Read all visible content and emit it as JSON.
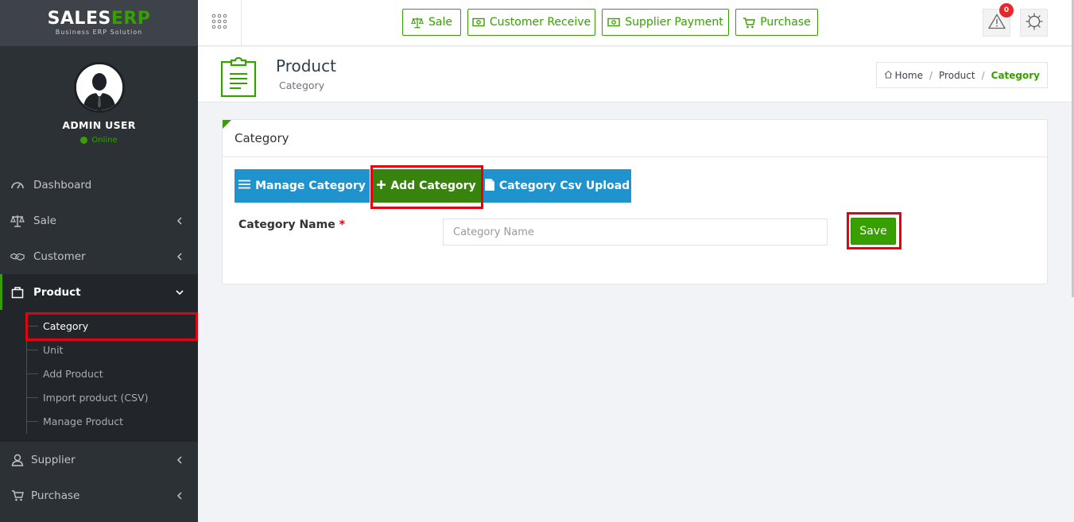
{
  "brand": {
    "logo_part1": "SALES",
    "logo_part2": "ERP",
    "tagline": "Business ERP Solution",
    "accent_color": "#37a000"
  },
  "user": {
    "name": "ADMIN USER",
    "status": "Online"
  },
  "sidebar": {
    "items": [
      {
        "label": "Dashboard",
        "icon": "dashboard-icon"
      },
      {
        "label": "Sale",
        "icon": "scale-icon"
      },
      {
        "label": "Customer",
        "icon": "handshake-icon"
      },
      {
        "label": "Product",
        "icon": "bag-icon",
        "active": true
      },
      {
        "label": "Supplier",
        "icon": "user-icon"
      },
      {
        "label": "Purchase",
        "icon": "cart-icon"
      }
    ],
    "product_submenu": [
      {
        "label": "Category",
        "active": true
      },
      {
        "label": "Unit"
      },
      {
        "label": "Add Product"
      },
      {
        "label": "Import product (CSV)"
      },
      {
        "label": "Manage Product"
      }
    ]
  },
  "topbar": {
    "quick_buttons": [
      {
        "label": "Sale",
        "icon": "scale-icon"
      },
      {
        "label": "Customer Receive",
        "icon": "money-icon"
      },
      {
        "label": "Supplier Payment",
        "icon": "money-icon"
      },
      {
        "label": "Purchase",
        "icon": "cart-icon"
      }
    ],
    "notification_count": "0"
  },
  "page_header": {
    "title": "Product",
    "subtitle": "Category",
    "breadcrumb": [
      "Home",
      "Product",
      "Category"
    ]
  },
  "panel": {
    "heading": "Category",
    "tabs": [
      {
        "label": "Manage Category",
        "icon": "list-icon"
      },
      {
        "label": "Add Category",
        "icon": "plus-icon",
        "active": true
      },
      {
        "label": "Category Csv Upload",
        "icon": "file-icon"
      }
    ],
    "form": {
      "label": "Category Name",
      "required_mark": "*",
      "placeholder": "Category Name",
      "value": ""
    },
    "save_label": "Save"
  }
}
